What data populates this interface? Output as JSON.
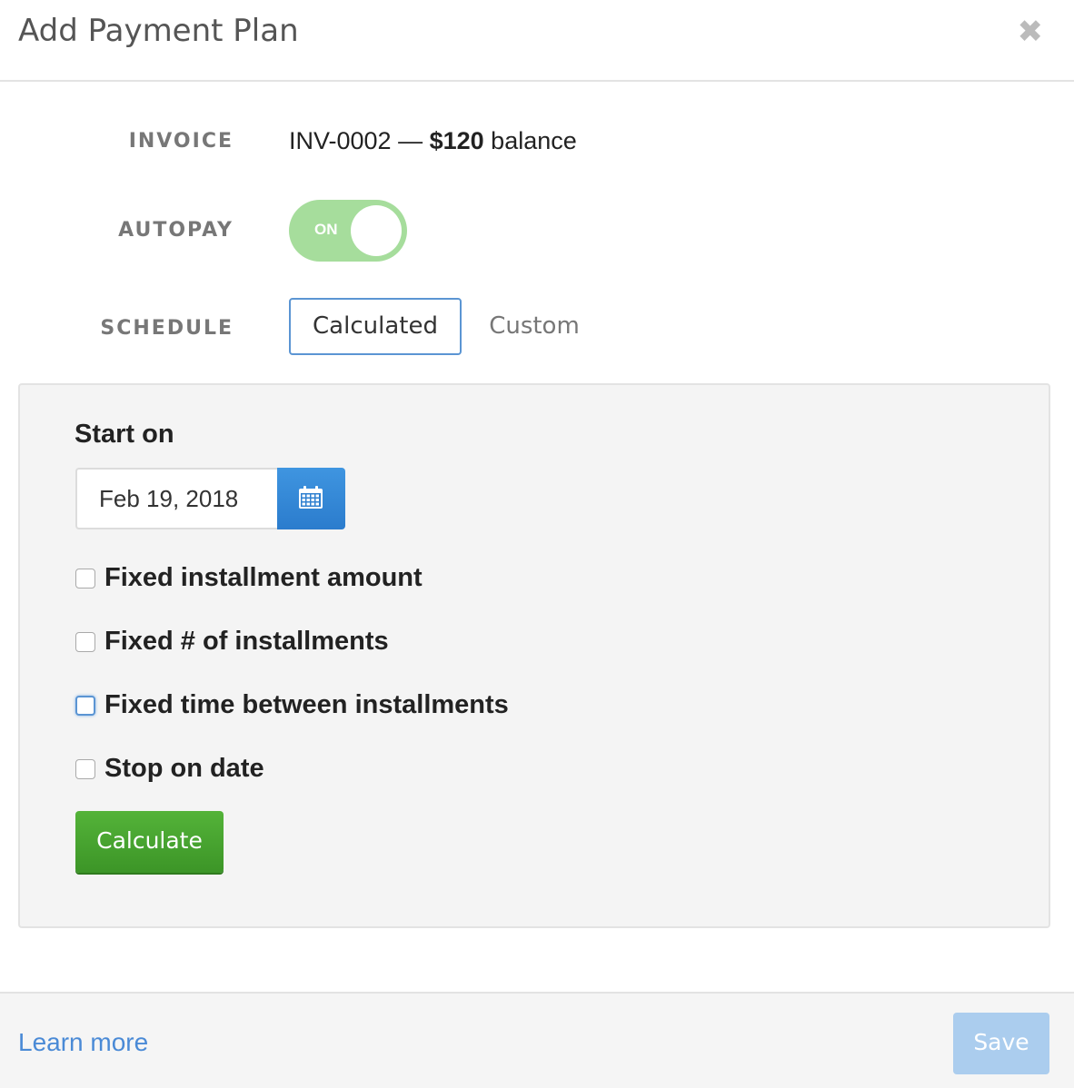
{
  "modal": {
    "title": "Add Payment Plan",
    "close_glyph": "✖"
  },
  "invoice": {
    "label": "INVOICE",
    "number": "INV-0002",
    "separator": " — ",
    "amount": "$120",
    "suffix": " balance"
  },
  "autopay": {
    "label": "AUTOPAY",
    "state": "ON",
    "color": "#a6dd9c"
  },
  "schedule": {
    "label": "SCHEDULE",
    "options": [
      "Calculated",
      "Custom"
    ],
    "selected": "Calculated"
  },
  "calculated": {
    "start_label": "Start on",
    "start_date": "Feb 19, 2018",
    "checkboxes": [
      {
        "label": "Fixed installment amount",
        "checked": false
      },
      {
        "label": "Fixed # of installments",
        "checked": false
      },
      {
        "label": "Fixed time between installments",
        "checked": false,
        "focused": true
      },
      {
        "label": "Stop on date",
        "checked": false
      }
    ],
    "calculate_label": "Calculate"
  },
  "footer": {
    "learn_more": "Learn more",
    "save_label": "Save"
  },
  "colors": {
    "accent_blue": "#2b7ccd",
    "green": "#3c9527",
    "save_disabled": "#abcdee"
  }
}
